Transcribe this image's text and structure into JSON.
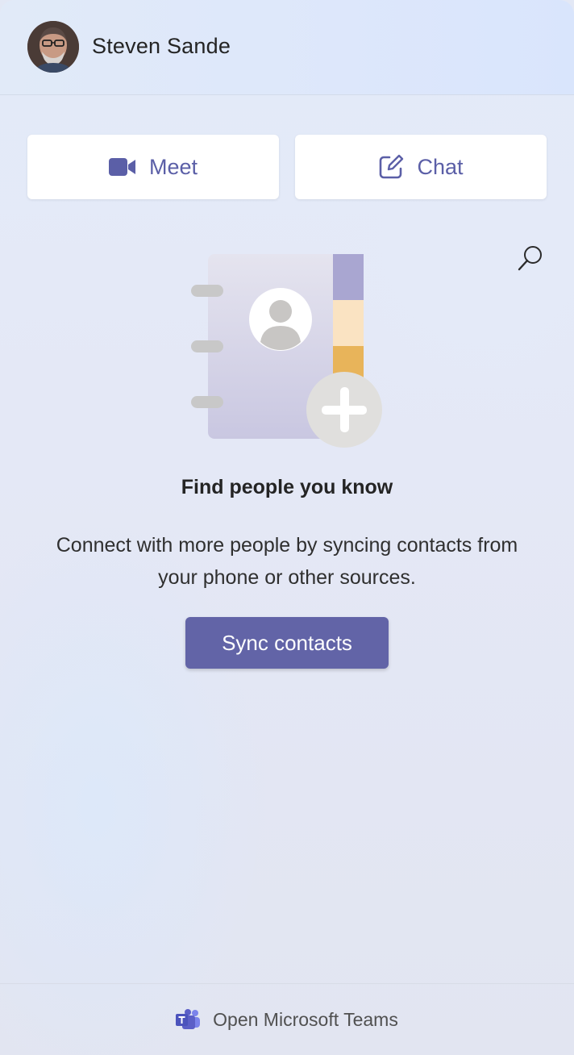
{
  "header": {
    "user_name": "Steven Sande",
    "avatar_icon": "user-avatar"
  },
  "actions": {
    "meet_label": "Meet",
    "meet_icon": "video-camera-icon",
    "chat_label": "Chat",
    "chat_icon": "compose-icon"
  },
  "search": {
    "icon": "search-icon"
  },
  "empty_state": {
    "illustration": "contact-book-add-illustration",
    "title": "Find people you know",
    "description": "Connect with more people by syncing contacts from your phone or other sources.",
    "button_label": "Sync contacts"
  },
  "footer": {
    "icon": "microsoft-teams-icon",
    "link_label": "Open Microsoft Teams"
  },
  "colors": {
    "accent": "#6264a7",
    "text_primary": "#242424",
    "background": "#e3e8f5"
  }
}
